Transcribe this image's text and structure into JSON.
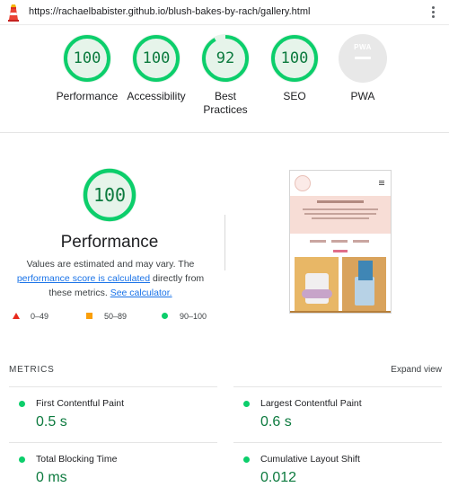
{
  "url_bar": {
    "url": "https://rachaelbabister.github.io/blush-bakes-by-rach/gallery.html"
  },
  "categories": [
    {
      "label": "Performance",
      "score": "100",
      "score_fraction": 1.0
    },
    {
      "label": "Accessibility",
      "score": "100",
      "score_fraction": 1.0
    },
    {
      "label": "Best Practices",
      "score": "92",
      "score_fraction": 0.92
    },
    {
      "label": "SEO",
      "score": "100",
      "score_fraction": 1.0
    },
    {
      "label": "PWA",
      "badge": "PWA"
    }
  ],
  "performance": {
    "score": "100",
    "score_fraction": 1.0,
    "title": "Performance",
    "description": {
      "text1": "Values are estimated and may vary. The ",
      "link1": "performance score is calculated",
      "text2": " directly from these metrics. ",
      "link2": "See calculator."
    },
    "legend": [
      {
        "range": "0–49",
        "shape": "triangle",
        "color": "#e8291c"
      },
      {
        "range": "50–89",
        "shape": "square",
        "color": "#fa9f0a"
      },
      {
        "range": "90–100",
        "shape": "circle",
        "color": "#0cce6b"
      }
    ]
  },
  "metrics": {
    "title": "METRICS",
    "expand_label": "Expand view",
    "items": [
      {
        "name": "First Contentful Paint",
        "value": "0.5 s"
      },
      {
        "name": "Largest Contentful Paint",
        "value": "0.6 s"
      },
      {
        "name": "Total Blocking Time",
        "value": "0 ms"
      },
      {
        "name": "Cumulative Layout Shift",
        "value": "0.012"
      }
    ]
  },
  "colors": {
    "pass": "#0cce6b",
    "pass_text": "#0c7a3e",
    "link": "#1a73e8"
  },
  "icons": {
    "app_logo": "lighthouse-icon",
    "menu": "kebab-menu-icon"
  }
}
